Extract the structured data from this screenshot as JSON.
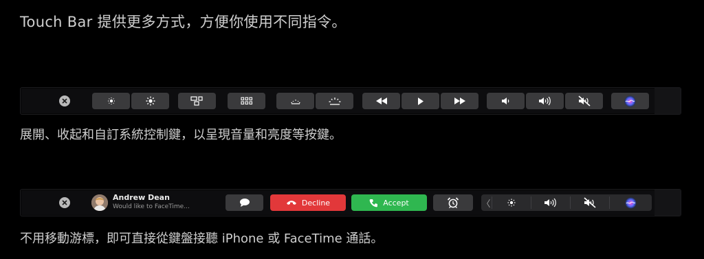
{
  "captions": {
    "top": "Touch Bar 提供更多方式，方便你使用不同指令。",
    "middle": "展開、收起和自訂系統控制鍵，以呈現音量和亮度等按鍵。",
    "bottom": "不用移動游標，即可直接從鍵盤接聽 iPhone 或 FaceTime 通話。"
  },
  "control_strip_bar": {
    "keys": [
      "close-icon",
      "brightness-down-icon",
      "brightness-up-icon",
      "mission-control-icon",
      "launchpad-icon",
      "keyboard-brightness-down-icon",
      "keyboard-brightness-up-icon",
      "rewind-icon",
      "play-icon",
      "fast-forward-icon",
      "volume-down-icon",
      "volume-up-icon",
      "mute-icon",
      "siri-icon"
    ]
  },
  "call_bar": {
    "caller_name": "Andrew Dean",
    "caller_subtitle": "Would like to FaceTime...",
    "decline_label": "Decline",
    "accept_label": "Accept",
    "colors": {
      "decline": "#e2383a",
      "accept": "#2fb750"
    }
  }
}
